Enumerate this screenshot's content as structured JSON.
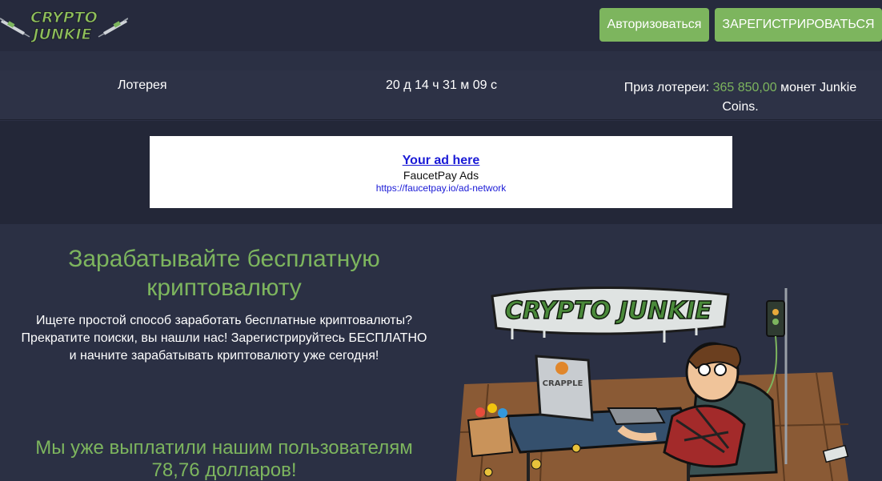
{
  "header": {
    "logo_text_line1": "CRYPTO",
    "logo_text_line2": "JUNKIE",
    "login_label": "Авторизоваться",
    "register_label": "ЗАРЕГИСТРИРОВАТЬСЯ"
  },
  "lottery": {
    "label": "Лотерея",
    "timer": "20 д 14 ч 31 м 09 с",
    "prize_prefix": "Приз лотереи: ",
    "prize_amount": "365 850,00",
    "prize_suffix": " монет Junkie Coins."
  },
  "ad": {
    "title": "Your ad here",
    "subtitle": "FaucetPay Ads",
    "url": "https://faucetpay.io/ad-network"
  },
  "hero": {
    "title": "Зарабатывайте бесплатную криптовалюту",
    "text": "Ищете простой способ заработать бесплатные криптовалюты? Прекратите поиски, вы нашли нас! Зарегистрируйтесь БЕСПЛАТНО и начните зарабатывать криптовалюту уже сегодня!",
    "paid_title": "Мы уже выплатили нашим пользователям 78,76 долларов!"
  },
  "illustration": {
    "graffiti_text": "CRYPTO JUNKIE",
    "monitor_label": "CRAPPLE"
  },
  "colors": {
    "accent": "#7db55e",
    "background": "#2b3044",
    "header_bg": "#262a3d",
    "ad_band_bg": "#232738"
  }
}
